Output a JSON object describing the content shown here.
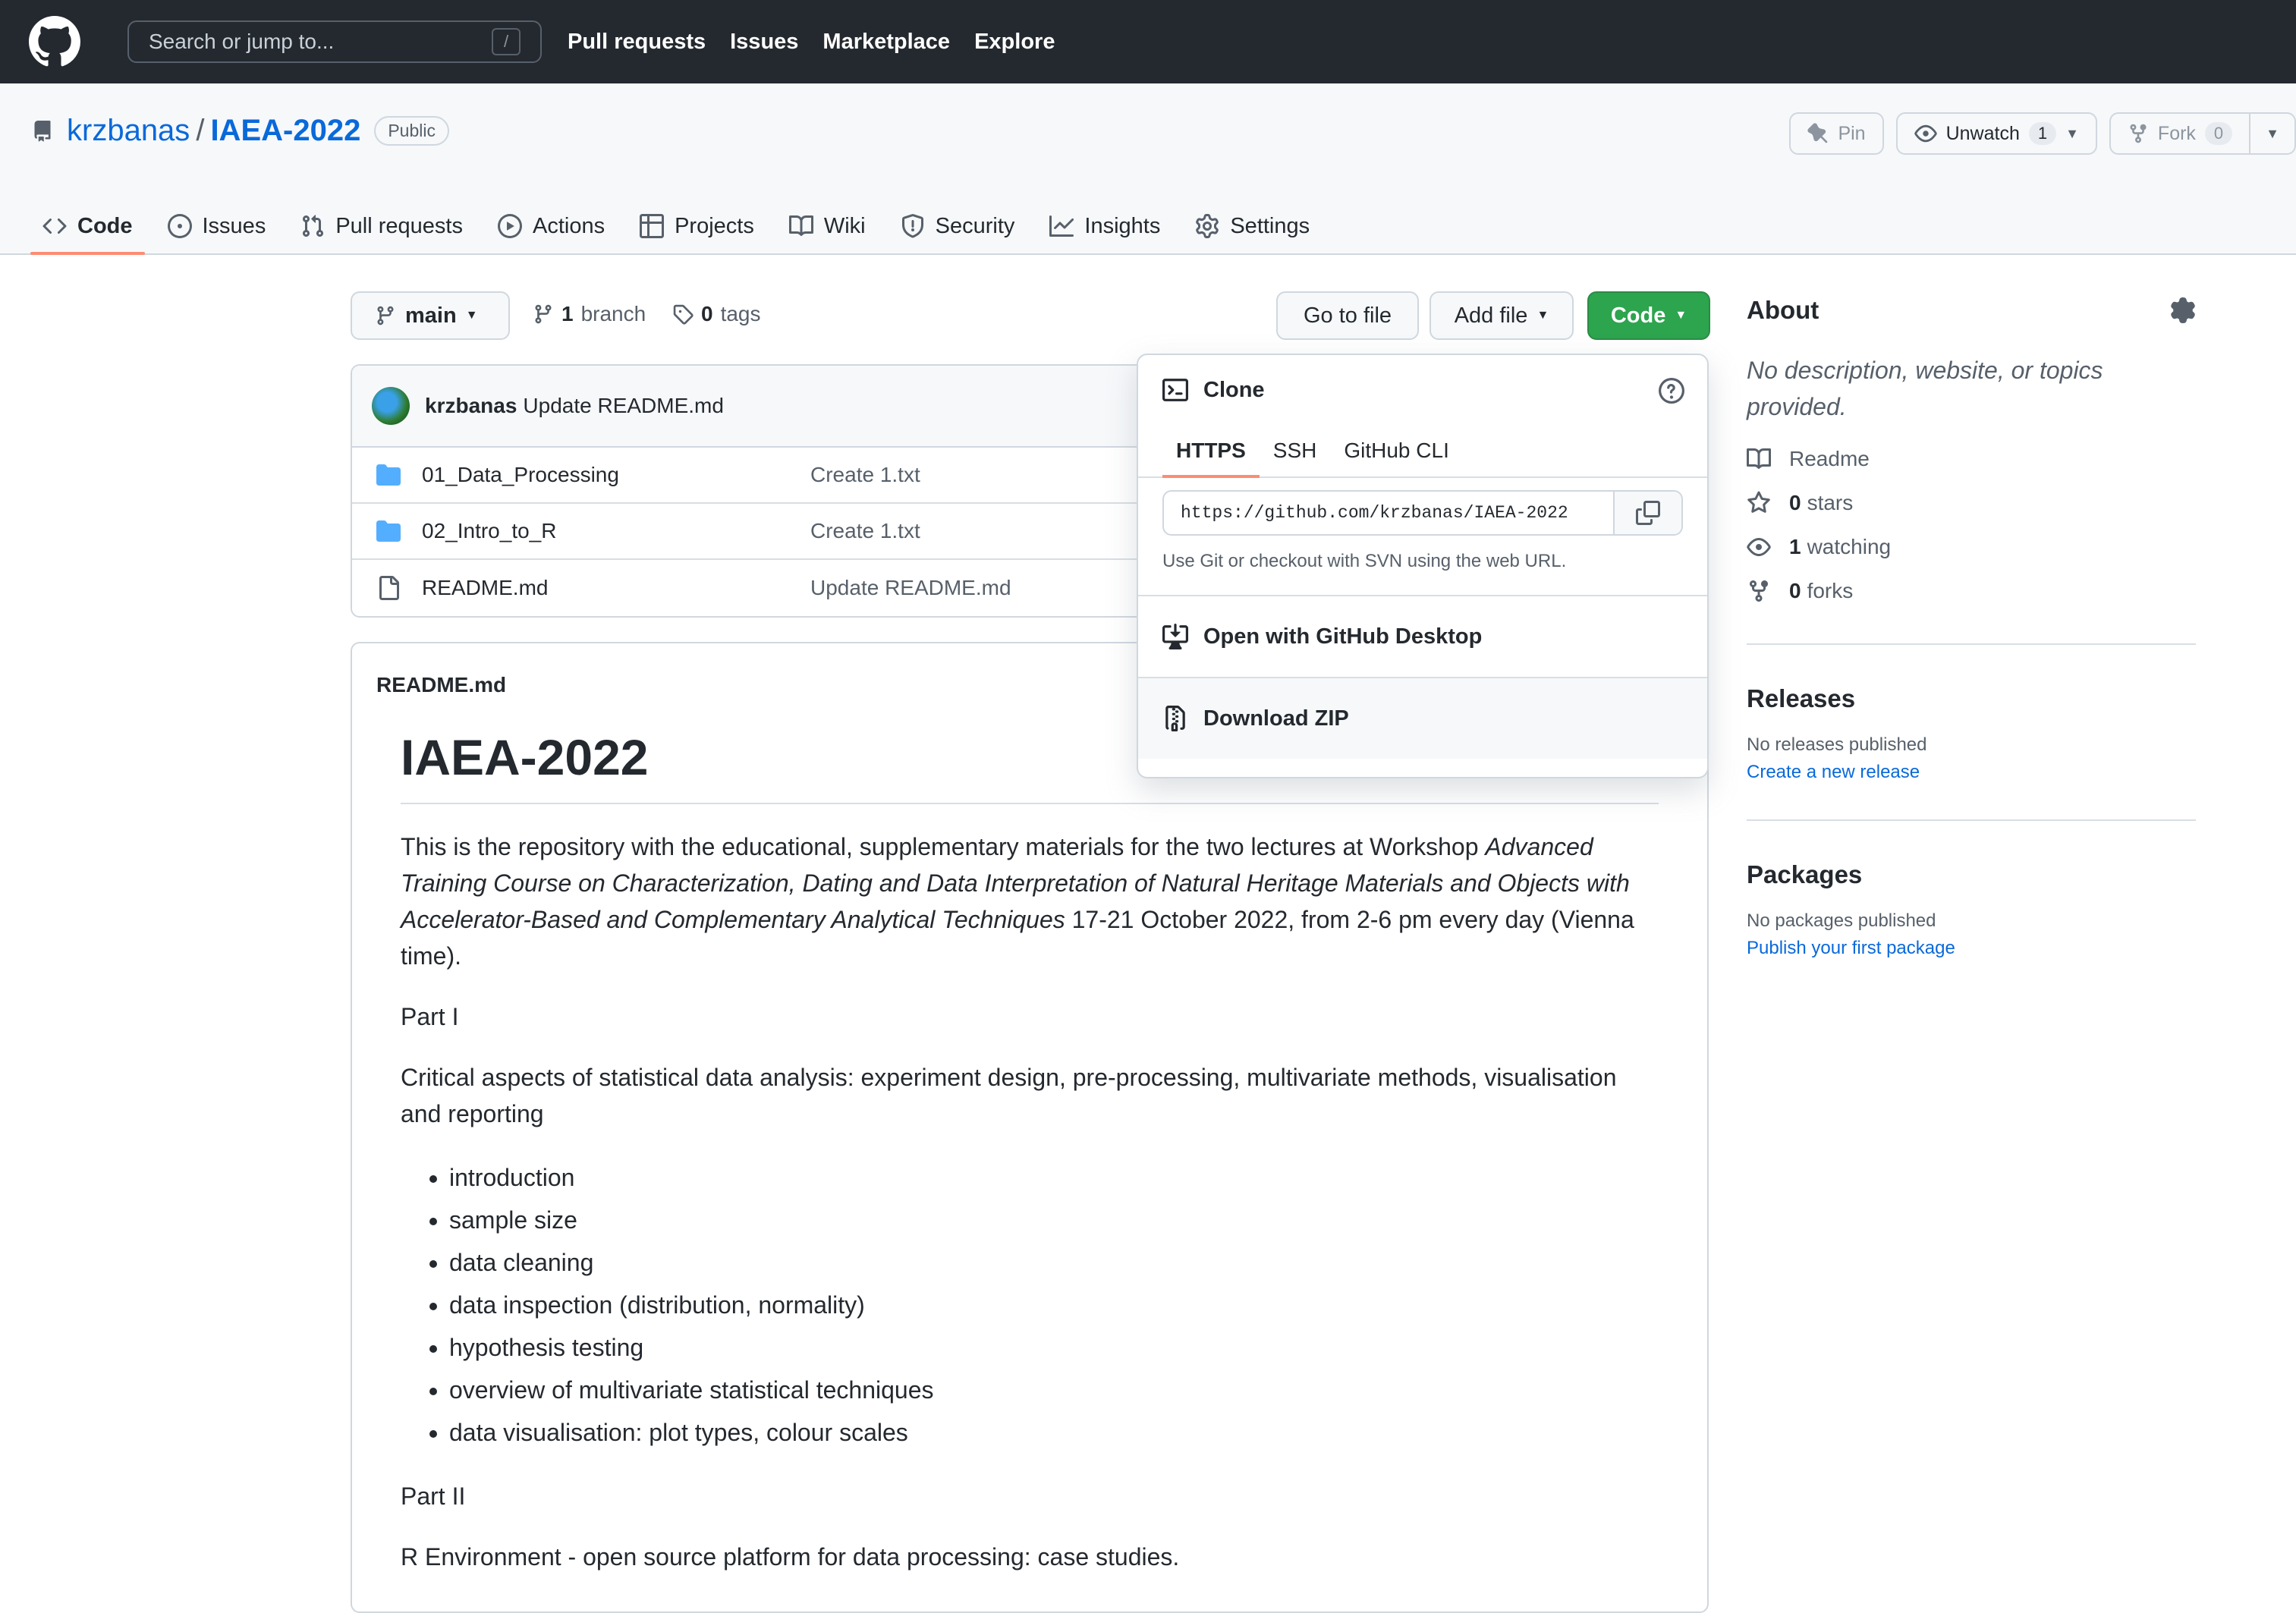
{
  "header": {
    "search_placeholder": "Search or jump to...",
    "slash_key": "/",
    "nav": [
      "Pull requests",
      "Issues",
      "Marketplace",
      "Explore"
    ]
  },
  "repo": {
    "owner": "krzbanas",
    "separator": "/",
    "name": "IAEA-2022",
    "visibility": "Public",
    "pin_label": "Pin",
    "unwatch_label": "Unwatch",
    "watch_count": "1",
    "fork_label": "Fork",
    "fork_count": "0"
  },
  "tabs": [
    {
      "label": "Code",
      "icon": "code-icon"
    },
    {
      "label": "Issues",
      "icon": "issue-icon"
    },
    {
      "label": "Pull requests",
      "icon": "pull-request-icon"
    },
    {
      "label": "Actions",
      "icon": "play-icon"
    },
    {
      "label": "Projects",
      "icon": "table-icon"
    },
    {
      "label": "Wiki",
      "icon": "book-icon"
    },
    {
      "label": "Security",
      "icon": "shield-icon"
    },
    {
      "label": "Insights",
      "icon": "graph-icon"
    },
    {
      "label": "Settings",
      "icon": "gear-icon"
    }
  ],
  "toolbar": {
    "branch": "main",
    "branch_count": "1",
    "branch_word": "branch",
    "tag_count": "0",
    "tag_word": "tags",
    "go_to_file": "Go to file",
    "add_file": "Add file",
    "code": "Code"
  },
  "commit": {
    "author": "krzbanas",
    "message": "Update README.md"
  },
  "files": [
    {
      "type": "folder",
      "name": "01_Data_Processing",
      "message": "Create 1.txt"
    },
    {
      "type": "folder",
      "name": "02_Intro_to_R",
      "message": "Create 1.txt"
    },
    {
      "type": "file",
      "name": "README.md",
      "message": "Update README.md"
    }
  ],
  "clone": {
    "title": "Clone",
    "tabs": [
      "HTTPS",
      "SSH",
      "GitHub CLI"
    ],
    "url": "https://github.com/krzbanas/IAEA-2022",
    "hint": "Use Git or checkout with SVN using the web URL.",
    "open_desktop": "Open with GitHub Desktop",
    "download_zip": "Download ZIP"
  },
  "readme": {
    "filename": "README.md",
    "title": "IAEA-2022",
    "intro_a": "This is the repository with the educational, supplementary materials for the two lectures at Workshop ",
    "intro_em": "Advanced Training Course on Characterization, Dating and Data Interpretation of Natural Heritage Materials and Objects with Accelerator-Based and Complementary Analytical Techniques",
    "intro_b": " 17-21 October 2022, from 2-6 pm every day (Vienna time).",
    "part1": "Part I",
    "part1_desc": "Critical aspects of statistical data analysis: experiment design, pre-processing, multivariate methods, visualisation and reporting",
    "part1_items": [
      "introduction",
      "sample size",
      "data cleaning",
      "data inspection (distribution, normality)",
      "hypothesis testing",
      "overview of multivariate statistical techniques",
      "data visualisation: plot types, colour scales"
    ],
    "part2": "Part II",
    "part2_desc": "R Environment - open source platform for data processing: case studies."
  },
  "sidebar": {
    "about_title": "About",
    "about_desc": "No description, website, or topics provided.",
    "readme_label": "Readme",
    "stars_count": "0",
    "stars_word": "stars",
    "watching_count": "1",
    "watching_word": "watching",
    "forks_count": "0",
    "forks_word": "forks",
    "releases_title": "Releases",
    "releases_none": "No releases published",
    "releases_link": "Create a new release",
    "packages_title": "Packages",
    "packages_none": "No packages published",
    "packages_link": "Publish your first package"
  },
  "colors": {
    "header_bg": "#24292f",
    "accent_link": "#0969da",
    "code_button": "#2da44e",
    "tab_underline": "#fd8c73",
    "folder": "#54aeff"
  }
}
